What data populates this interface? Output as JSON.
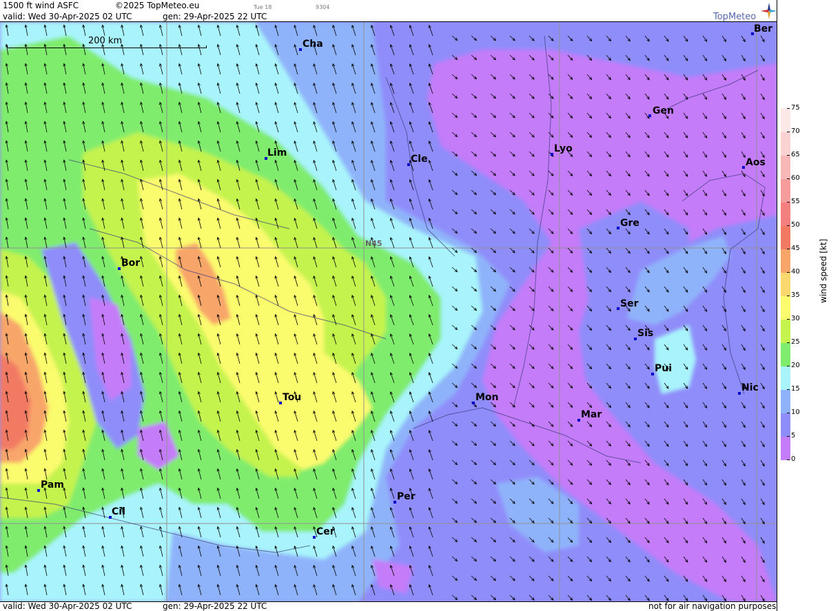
{
  "header": {
    "product": "1500 ft wind ASFC",
    "copyright": "©2025 TopMeteo.eu",
    "aux_day": "Tue 18",
    "aux_code": "9304",
    "valid": "valid:  Wed  30-Apr-2025  02 UTC",
    "gen": "gen: 29-Apr-2025 22 UTC"
  },
  "footer": {
    "valid": "valid:  Wed  30-Apr-2025  02 UTC",
    "gen": "gen: 29-Apr-2025 22 UTC",
    "disclaimer": "not for air navigation purposes"
  },
  "brand": {
    "name": "TopMeteo"
  },
  "scale": {
    "label": "200 km"
  },
  "latitude_label": "N45",
  "cities": [
    {
      "name": "Ber"
    },
    {
      "name": "Cha"
    },
    {
      "name": "Gen"
    },
    {
      "name": "Lim"
    },
    {
      "name": "Cle"
    },
    {
      "name": "Lyo"
    },
    {
      "name": "Aos"
    },
    {
      "name": "Gre"
    },
    {
      "name": "Bor"
    },
    {
      "name": "Ser"
    },
    {
      "name": "Sis"
    },
    {
      "name": "Pui"
    },
    {
      "name": "Tou"
    },
    {
      "name": "Mon"
    },
    {
      "name": "Nic"
    },
    {
      "name": "Mar"
    },
    {
      "name": "Pam"
    },
    {
      "name": "Cil"
    },
    {
      "name": "Per"
    },
    {
      "name": "Cer"
    }
  ],
  "legend": {
    "title": "wind speed [kt]",
    "ticks": [
      "0",
      "5",
      "10",
      "15",
      "20",
      "25",
      "30",
      "35",
      "40",
      "45",
      "50",
      "55",
      "60",
      "65",
      "70",
      "75"
    ],
    "colors": [
      "#c57cf9",
      "#8f8dfa",
      "#8fb3fa",
      "#a9f4fc",
      "#7fec6d",
      "#c4f34e",
      "#fbfb6e",
      "#fbd86e",
      "#f8a56a",
      "#f27a63",
      "#f47f7f",
      "#f69c9c",
      "#f8b8b8",
      "#fad2d2",
      "#fde8e8"
    ]
  }
}
